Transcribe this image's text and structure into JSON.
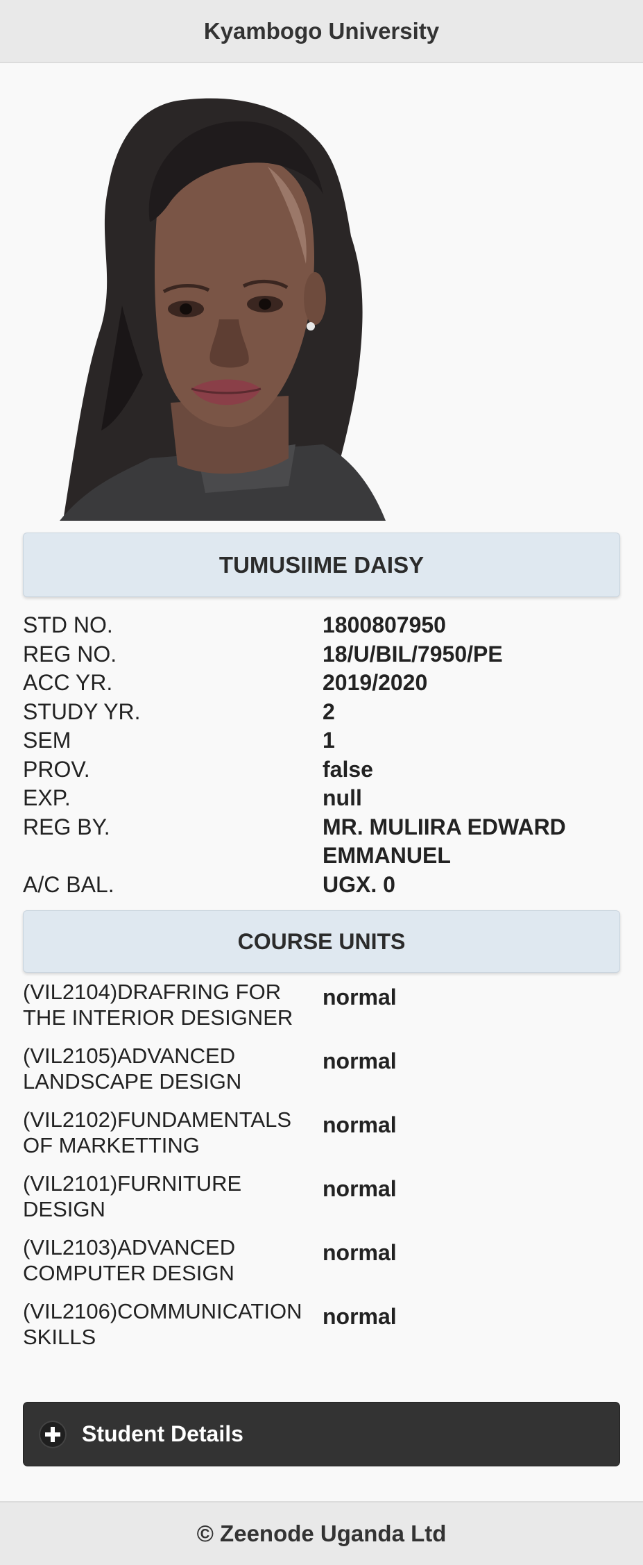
{
  "header": {
    "title": "Kyambogo University"
  },
  "student": {
    "name": "TUMUSIIME DAISY",
    "fields": [
      {
        "label": "STD NO.",
        "value": "1800807950"
      },
      {
        "label": "REG NO.",
        "value": "18/U/BIL/7950/PE"
      },
      {
        "label": "ACC YR.",
        "value": "2019/2020"
      },
      {
        "label": "STUDY YR.",
        "value": "2"
      },
      {
        "label": "SEM",
        "value": "1"
      },
      {
        "label": "PROV.",
        "value": "false"
      },
      {
        "label": "EXP.",
        "value": "null"
      },
      {
        "label": "REG BY.",
        "value": "MR. MULIIRA EDWARD EMMANUEL"
      },
      {
        "label": "A/C BAL.",
        "value": "UGX. 0"
      }
    ]
  },
  "course_units": {
    "heading": "COURSE UNITS",
    "items": [
      {
        "name": "(VIL2104)DRAFRING FOR THE INTERIOR DESIGNER",
        "status": "normal"
      },
      {
        "name": "(VIL2105)ADVANCED LANDSCAPE DESIGN",
        "status": "normal"
      },
      {
        "name": "(VIL2102)FUNDAMENTALS OF MARKETTING",
        "status": "normal"
      },
      {
        "name": "(VIL2101)FURNITURE DESIGN",
        "status": "normal"
      },
      {
        "name": "(VIL2103)ADVANCED COMPUTER DESIGN",
        "status": "normal"
      },
      {
        "name": "(VIL2106)COMMUNICATION SKILLS",
        "status": "normal"
      }
    ]
  },
  "details_button": {
    "label": "Student Details",
    "icon": "plus-icon"
  },
  "footer": {
    "text": "© Zeenode Uganda Ltd"
  }
}
